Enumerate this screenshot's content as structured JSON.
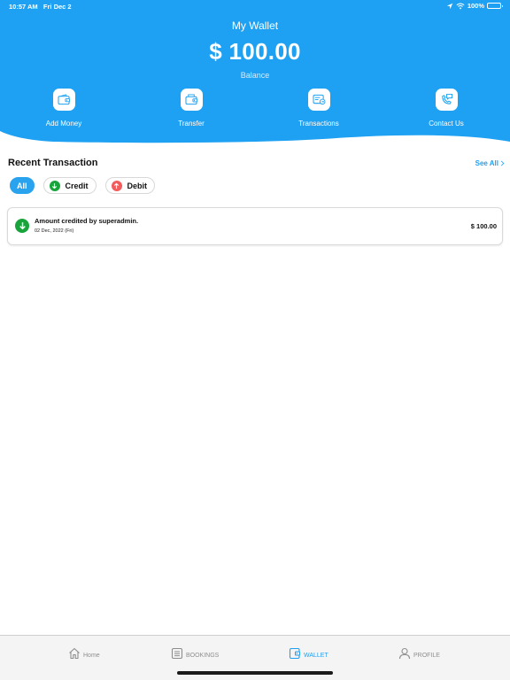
{
  "status_bar": {
    "time": "10:57 AM",
    "date": "Fri Dec 2",
    "battery": "100%"
  },
  "header": {
    "title": "My Wallet",
    "balance": "$ 100.00",
    "balance_label": "Balance",
    "bg_color": "#1ea1f2"
  },
  "actions": [
    {
      "label": "Add Money",
      "icon": "wallet-add-icon"
    },
    {
      "label": "Transfer",
      "icon": "wallet-transfer-icon"
    },
    {
      "label": "Transactions",
      "icon": "transactions-icon"
    },
    {
      "label": "Contact Us",
      "icon": "phone-chat-icon"
    }
  ],
  "recent": {
    "title": "Recent Transaction",
    "see_all": "See All",
    "filters": {
      "all": "All",
      "credit": "Credit",
      "debit": "Debit"
    }
  },
  "transactions": [
    {
      "title": "Amount credited by superadmin.",
      "date": "02 Dec, 2022 (Fri)",
      "amount": "$ 100.00",
      "type": "credit"
    }
  ],
  "tabs": [
    {
      "label": "Home",
      "icon": "home-icon",
      "active": false
    },
    {
      "label": "BOOKINGS",
      "icon": "bookings-icon",
      "active": false
    },
    {
      "label": "WALLET",
      "icon": "wallet-icon",
      "active": true
    },
    {
      "label": "PROFILE",
      "icon": "profile-icon",
      "active": false
    }
  ],
  "colors": {
    "accent": "#1ea1f2",
    "credit": "#18a43b",
    "debit": "#f25c5c"
  }
}
